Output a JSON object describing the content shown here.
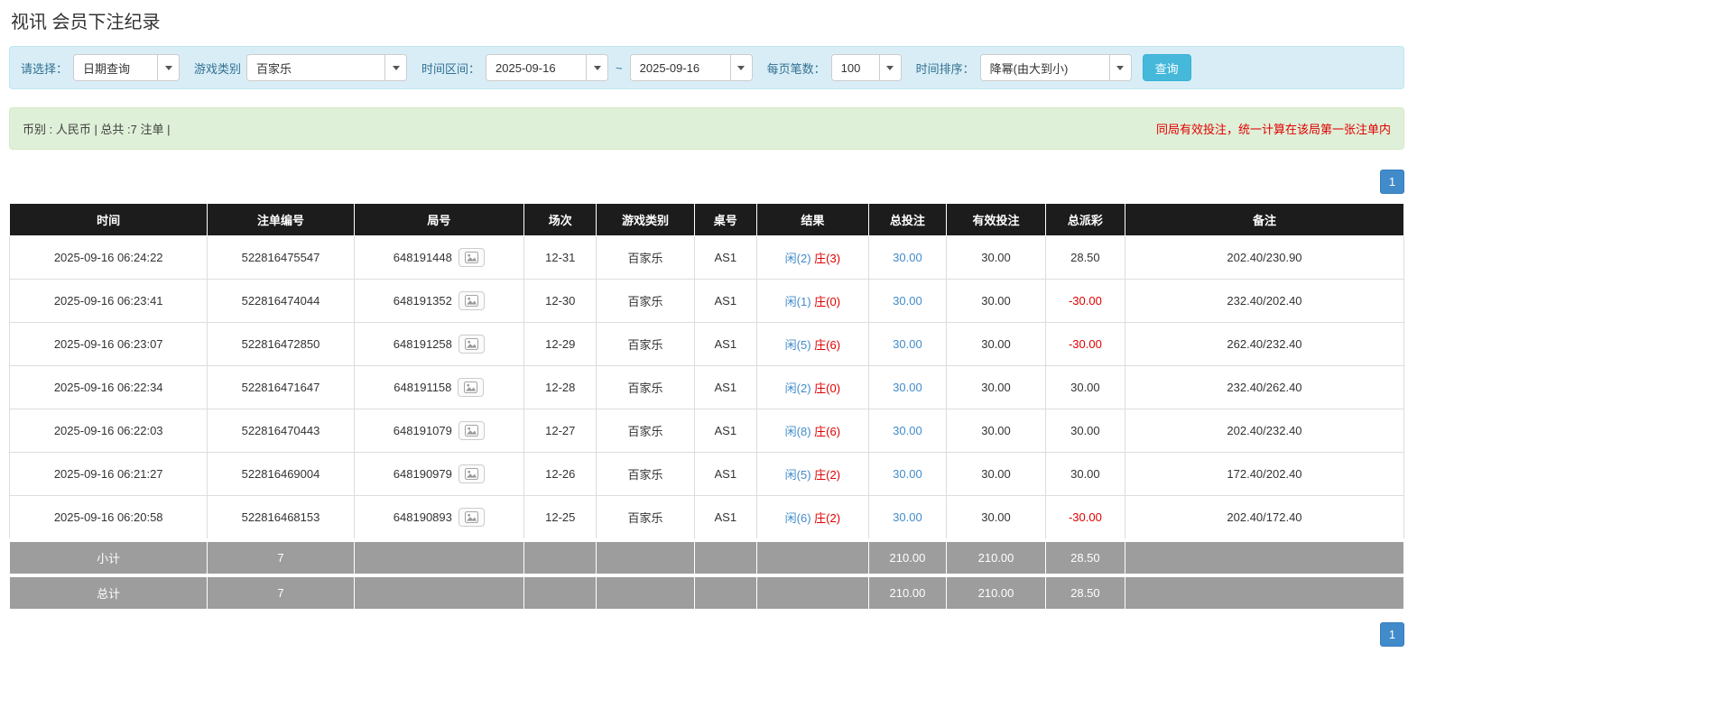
{
  "page": {
    "title": "视讯 会员下注纪录"
  },
  "colors": {
    "accent_blue": "#428bca",
    "negative_red": "#e00000",
    "player_blue": "#428bca",
    "banker_red": "#e00000",
    "header_bg": "#1c1c1c",
    "footer_bg": "#9d9d9d",
    "filter_bg": "#d9edf7",
    "summary_bg": "#dff0d8",
    "query_button_bg": "#46b8da"
  },
  "filters": {
    "select_label": "请选择：",
    "select_value": "日期查询",
    "game_label": "游戏类别",
    "game_value": "百家乐",
    "range_label": "时间区间：",
    "date_from": "2025-09-16",
    "range_separator": "~",
    "date_to": "2025-09-16",
    "per_page_label": "每页笔数：",
    "per_page_value": "100",
    "sort_label": "时间排序：",
    "sort_value": "降幂(由大到小)",
    "query_button": "查询"
  },
  "summary": {
    "info": "币别 : 人民币 | 总共 :7 注单 |",
    "notice": "同局有效投注，统一计算在该局第一张注单内"
  },
  "pagination": {
    "current": "1"
  },
  "table": {
    "headers": [
      "时间",
      "注单编号",
      "局号",
      "场次",
      "游戏类别",
      "桌号",
      "结果",
      "总投注",
      "有效投注",
      "总派彩",
      "备注"
    ],
    "rows": [
      {
        "time": "2025-09-16 06:24:22",
        "bet_id": "522816475547",
        "round_id": "648191448",
        "session": "12-31",
        "game": "百家乐",
        "table_no": "AS1",
        "player": "闲(2)",
        "banker": "庄(3)",
        "total_bet": "30.00",
        "valid_bet": "30.00",
        "payout": "28.50",
        "remark": "202.40/230.90"
      },
      {
        "time": "2025-09-16 06:23:41",
        "bet_id": "522816474044",
        "round_id": "648191352",
        "session": "12-30",
        "game": "百家乐",
        "table_no": "AS1",
        "player": "闲(1)",
        "banker": "庄(0)",
        "total_bet": "30.00",
        "valid_bet": "30.00",
        "payout": "-30.00",
        "remark": "232.40/202.40"
      },
      {
        "time": "2025-09-16 06:23:07",
        "bet_id": "522816472850",
        "round_id": "648191258",
        "session": "12-29",
        "game": "百家乐",
        "table_no": "AS1",
        "player": "闲(5)",
        "banker": "庄(6)",
        "total_bet": "30.00",
        "valid_bet": "30.00",
        "payout": "-30.00",
        "remark": "262.40/232.40"
      },
      {
        "time": "2025-09-16 06:22:34",
        "bet_id": "522816471647",
        "round_id": "648191158",
        "session": "12-28",
        "game": "百家乐",
        "table_no": "AS1",
        "player": "闲(2)",
        "banker": "庄(0)",
        "total_bet": "30.00",
        "valid_bet": "30.00",
        "payout": "30.00",
        "remark": "232.40/262.40"
      },
      {
        "time": "2025-09-16 06:22:03",
        "bet_id": "522816470443",
        "round_id": "648191079",
        "session": "12-27",
        "game": "百家乐",
        "table_no": "AS1",
        "player": "闲(8)",
        "banker": "庄(6)",
        "total_bet": "30.00",
        "valid_bet": "30.00",
        "payout": "30.00",
        "remark": "202.40/232.40"
      },
      {
        "time": "2025-09-16 06:21:27",
        "bet_id": "522816469004",
        "round_id": "648190979",
        "session": "12-26",
        "game": "百家乐",
        "table_no": "AS1",
        "player": "闲(5)",
        "banker": "庄(2)",
        "total_bet": "30.00",
        "valid_bet": "30.00",
        "payout": "30.00",
        "remark": "172.40/202.40"
      },
      {
        "time": "2025-09-16 06:20:58",
        "bet_id": "522816468153",
        "round_id": "648190893",
        "session": "12-25",
        "game": "百家乐",
        "table_no": "AS1",
        "player": "闲(6)",
        "banker": "庄(2)",
        "total_bet": "30.00",
        "valid_bet": "30.00",
        "payout": "-30.00",
        "remark": "202.40/172.40"
      }
    ],
    "subtotal": {
      "label": "小计",
      "count": "7",
      "total_bet": "210.00",
      "valid_bet": "210.00",
      "payout": "28.50"
    },
    "total": {
      "label": "总计",
      "count": "7",
      "total_bet": "210.00",
      "valid_bet": "210.00",
      "payout": "28.50"
    }
  }
}
